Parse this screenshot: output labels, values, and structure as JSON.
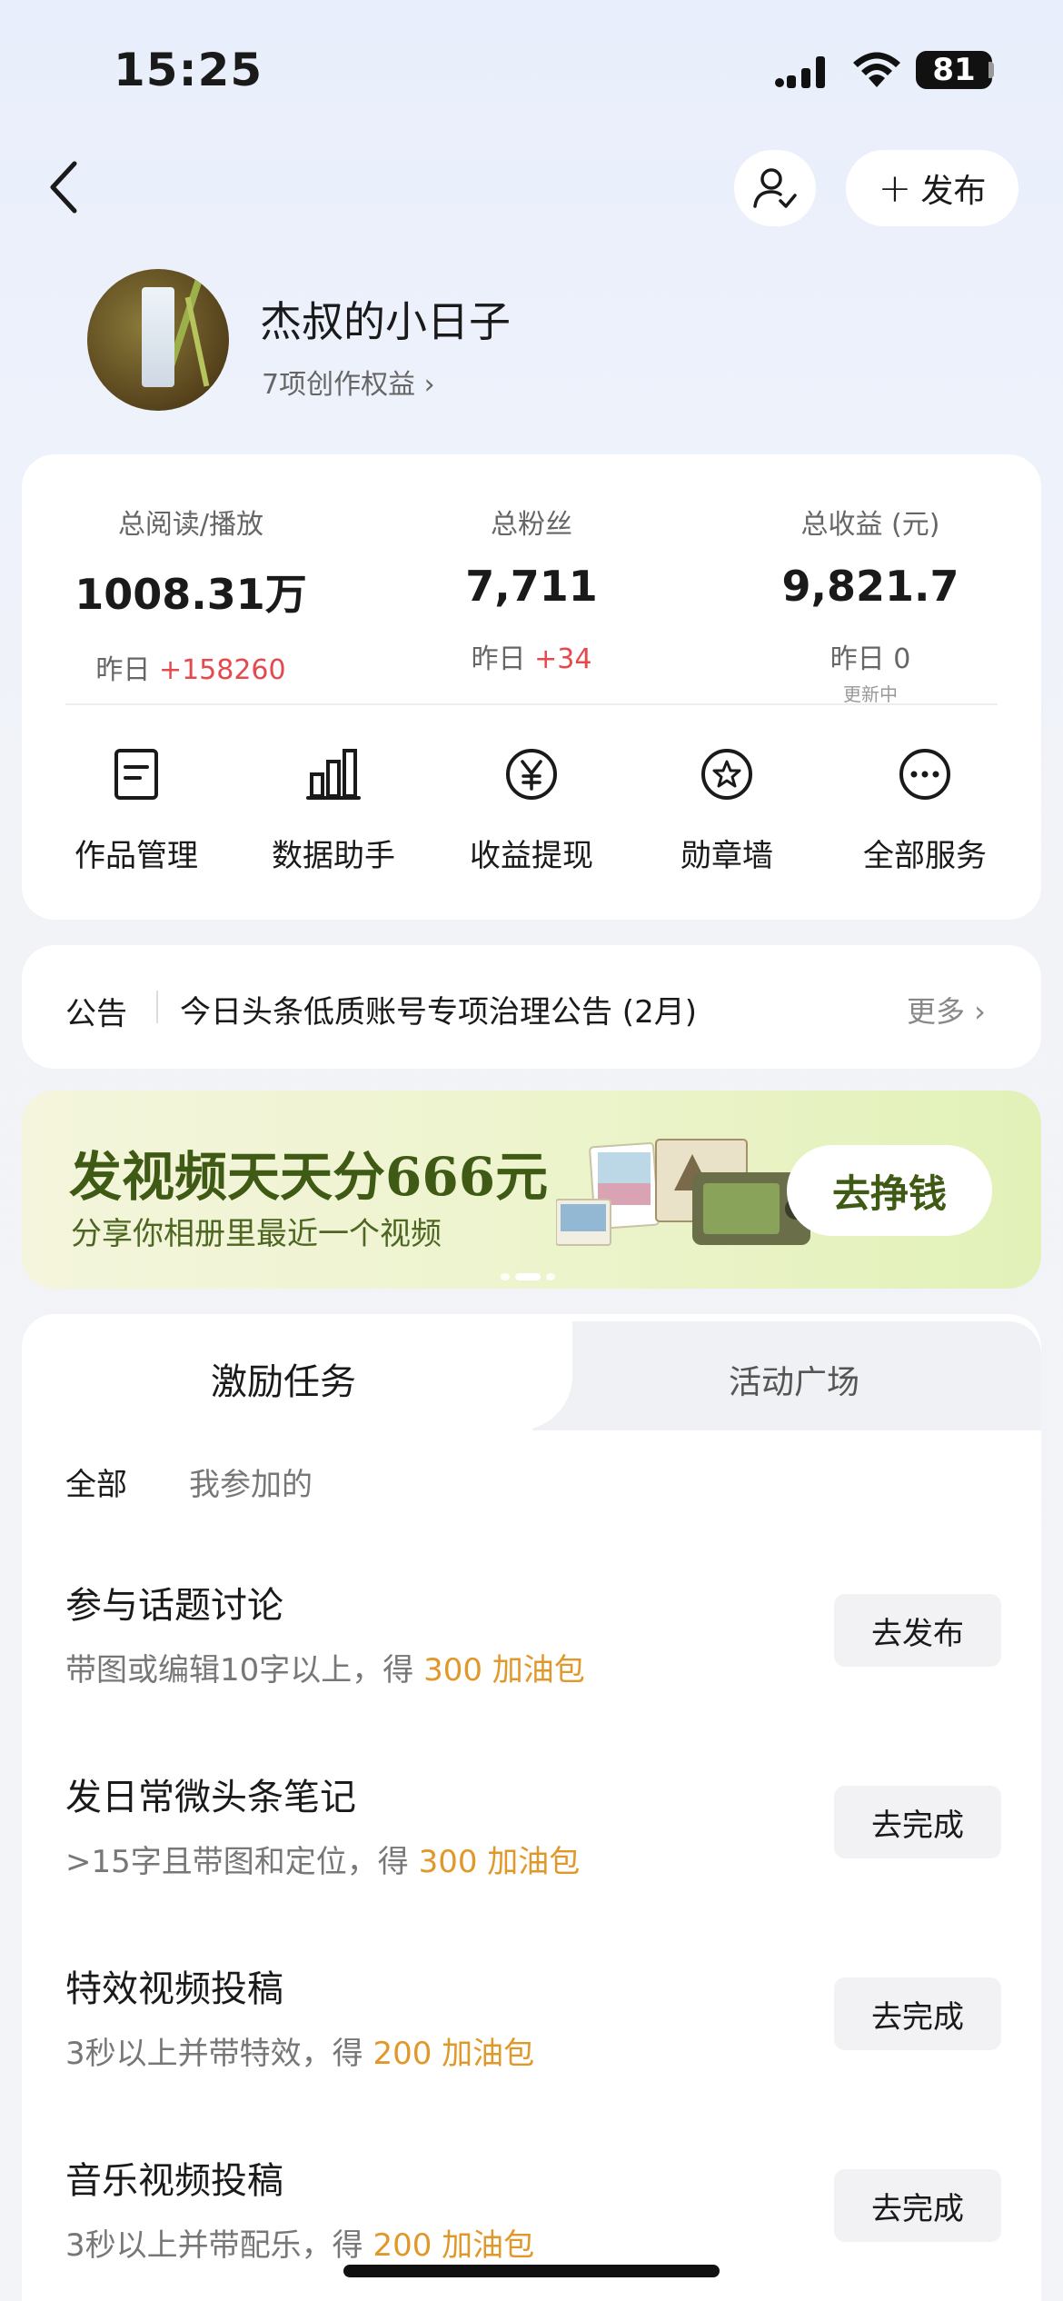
{
  "status_bar": {
    "time": "15:25",
    "battery": "81"
  },
  "nav": {
    "publish_label": "发布"
  },
  "profile": {
    "name": "杰叔的小日子",
    "benefits": "7项创作权益 ›"
  },
  "stats": [
    {
      "label": "总阅读/播放",
      "value": "1008.31万",
      "delta_prefix": "昨日 ",
      "delta": "+158260",
      "sub": ""
    },
    {
      "label": "总粉丝",
      "value": "7,711",
      "delta_prefix": "昨日 ",
      "delta": "+34",
      "sub": ""
    },
    {
      "label": "总收益 (元)",
      "value": "9,821.7",
      "delta_prefix": "昨日 0",
      "delta": "",
      "sub": "更新中"
    }
  ],
  "services": [
    {
      "label": "作品管理",
      "icon": "document-icon"
    },
    {
      "label": "数据助手",
      "icon": "bar-chart-icon"
    },
    {
      "label": "收益提现",
      "icon": "yen-icon"
    },
    {
      "label": "勋章墙",
      "icon": "medal-icon"
    },
    {
      "label": "全部服务",
      "icon": "more-icon"
    }
  ],
  "notice": {
    "tag": "公告",
    "text": "今日头条低质账号专项治理公告 (2月)",
    "more": "更多 ›"
  },
  "banner": {
    "title": "发视频天天分666元",
    "subtitle": "分享你相册里最近一个视频",
    "button": "去挣钱"
  },
  "tabs": {
    "active": "激励任务",
    "inactive": "活动广场"
  },
  "filters": {
    "all": "全部",
    "mine": "我参加的"
  },
  "tasks": [
    {
      "title": "参与话题讨论",
      "desc": "带图或编辑10字以上，得 ",
      "reward": "300 加油包",
      "button": "去发布"
    },
    {
      "title": "发日常微头条笔记",
      "desc": ">15字且带图和定位，得 ",
      "reward": "300 加油包",
      "button": "去完成"
    },
    {
      "title": "特效视频投稿",
      "desc": "3秒以上并带特效，得 ",
      "reward": "200 加油包",
      "button": "去完成"
    },
    {
      "title": "音乐视频投稿",
      "desc": "3秒以上并带配乐，得 ",
      "reward": "200 加油包",
      "button": "去完成"
    }
  ]
}
